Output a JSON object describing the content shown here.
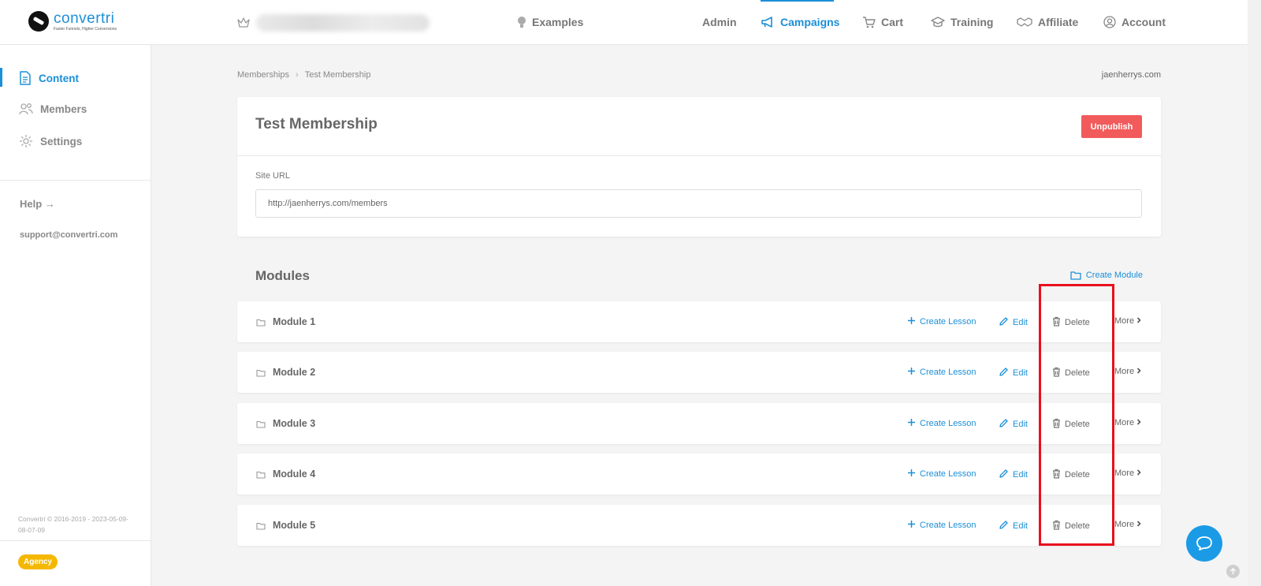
{
  "brand": {
    "name": "convertri",
    "tagline": "Faster Funnels, Higher Conversions",
    "color": "#1b8fd8"
  },
  "topnav": {
    "examples": "Examples",
    "admin": "Admin",
    "campaigns": "Campaigns",
    "cart": "Cart",
    "training": "Training",
    "affiliate": "Affiliate",
    "account": "Account"
  },
  "sidebar": {
    "items": [
      {
        "label": "Content",
        "icon": "document-icon",
        "active": true
      },
      {
        "label": "Members",
        "icon": "members-icon",
        "active": false
      },
      {
        "label": "Settings",
        "icon": "gear-icon",
        "active": false
      }
    ],
    "help": "Help →",
    "support": "support@convertri.com",
    "copyright": "Convertri © 2016-2019 - 2023-05-09-08-07-09",
    "badge": "Agency"
  },
  "breadcrumb": {
    "parent": "Memberships",
    "current": "Test Membership"
  },
  "domain": "jaenherrys.com",
  "membership": {
    "title": "Test Membership",
    "unpublish": "Unpublish",
    "site_url_label": "Site URL",
    "site_url": "http://jaenherrys.com/members"
  },
  "modules": {
    "title": "Modules",
    "create_module": "Create Module",
    "actions": {
      "create_lesson": "Create Lesson",
      "edit": "Edit",
      "delete": "Delete",
      "more": "More"
    },
    "rows": [
      {
        "name": "Module 1"
      },
      {
        "name": "Module 2"
      },
      {
        "name": "Module 3"
      },
      {
        "name": "Module 4"
      },
      {
        "name": "Module 5"
      }
    ]
  },
  "colors": {
    "accent": "#1b8fd8",
    "danger": "#f25b5b",
    "highlight": "#e8101c",
    "badge": "#f5b800"
  }
}
